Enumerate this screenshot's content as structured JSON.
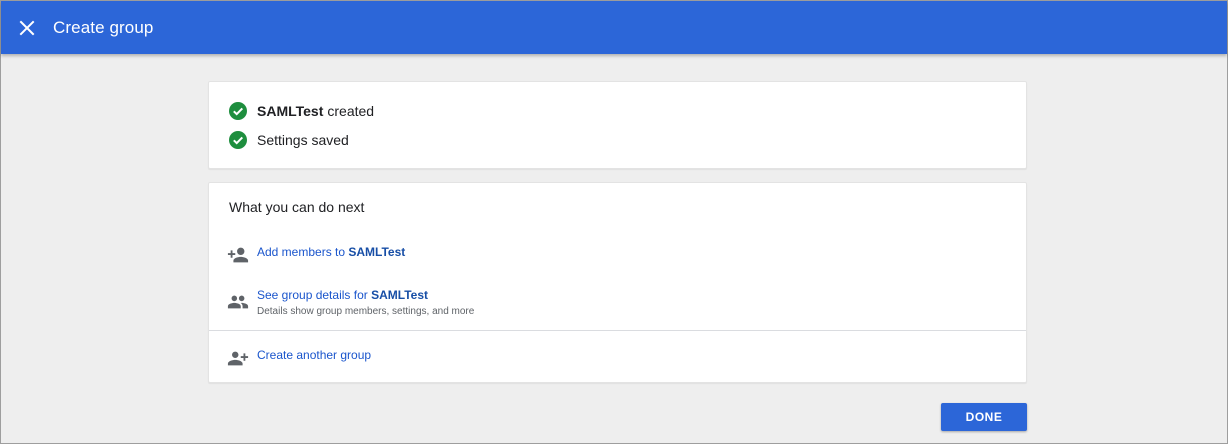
{
  "header": {
    "title": "Create group",
    "close_icon": "close-icon",
    "bg_color": "#2c66d8"
  },
  "status": {
    "items": [
      {
        "bold": "SAMLTest",
        "text": "created",
        "icon": "check-circle-icon"
      },
      {
        "bold": "",
        "text": "Settings saved",
        "icon": "check-circle-icon"
      }
    ],
    "check_color": "#1e8e3e"
  },
  "next": {
    "heading": "What you can do next",
    "actions": [
      {
        "label": "Add members to",
        "group": "SAMLTest",
        "icon": "person-add-icon"
      },
      {
        "label": "See group details for",
        "group": "SAMLTest",
        "sub": "Details show group members, settings, and more",
        "icon": "group-icon"
      },
      {
        "label": "Create another group",
        "icon": "group-add-icon"
      }
    ]
  },
  "footer": {
    "done_label": "DONE"
  }
}
